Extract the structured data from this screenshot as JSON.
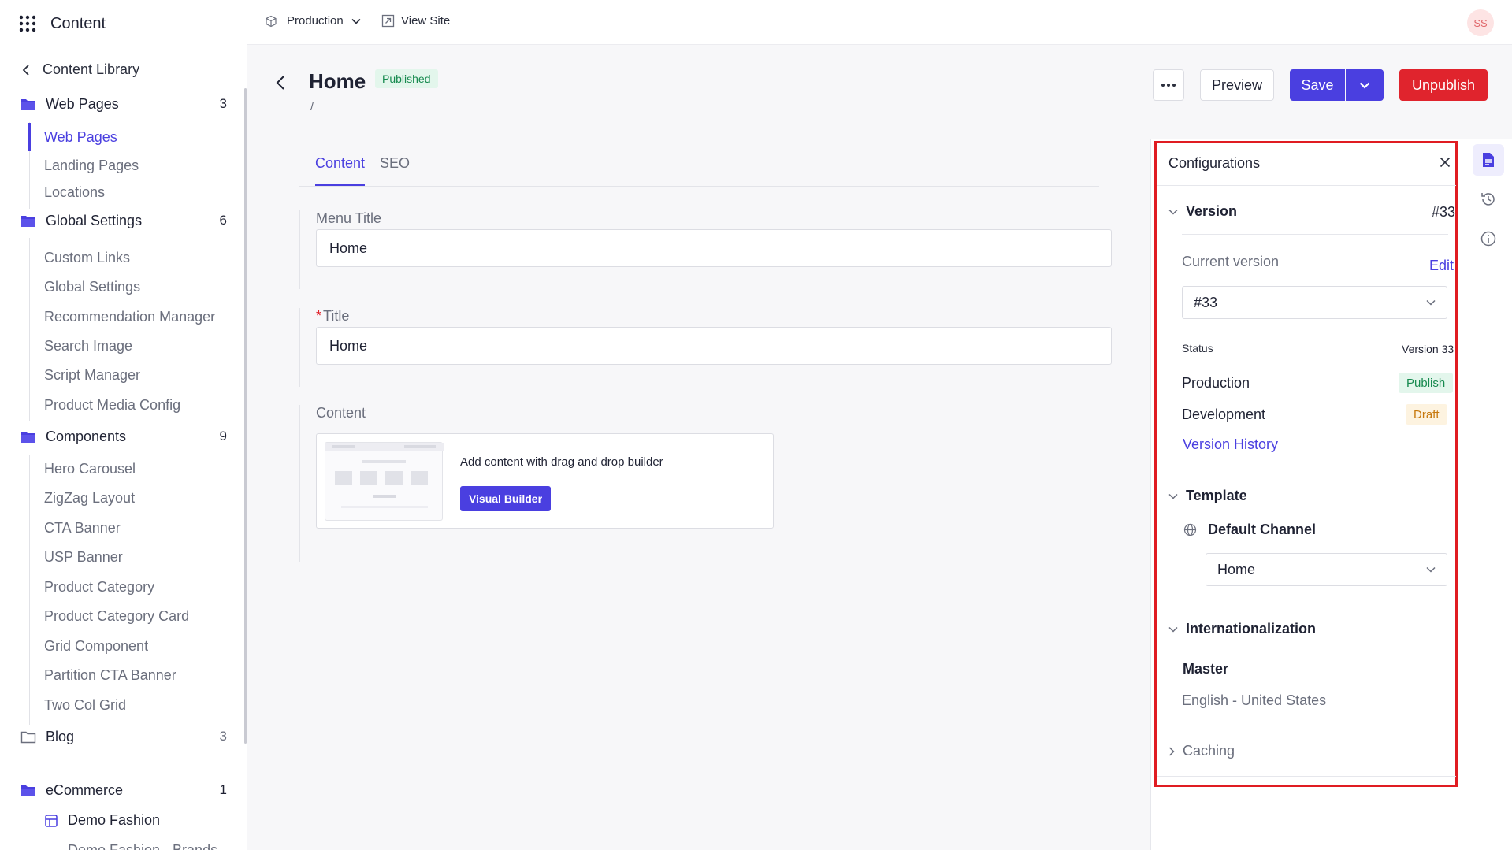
{
  "app": {
    "title": "Content"
  },
  "topbar": {
    "environment": "Production",
    "view_site": "View Site",
    "avatar_initials": "SS"
  },
  "sidebar": {
    "back_label": "Content Library",
    "folders": [
      {
        "name": "Web Pages",
        "count": "3",
        "items": [
          "Web Pages",
          "Landing Pages",
          "Locations"
        ],
        "active_item": "Web Pages"
      },
      {
        "name": "Global Settings",
        "count": "6",
        "items": [
          "Custom Links",
          "Global Settings",
          "Recommendation Manager",
          "Search Image",
          "Script Manager",
          "Product Media Config"
        ]
      },
      {
        "name": "Components",
        "count": "9",
        "items": [
          "Hero Carousel",
          "ZigZag Layout",
          "CTA Banner",
          "USP Banner",
          "Product Category",
          "Product Category Card",
          "Grid Component",
          "Partition CTA Banner",
          "Two Col Grid"
        ]
      },
      {
        "name": "Blog",
        "count": "3",
        "items": []
      },
      {
        "name": "eCommerce",
        "count": "1",
        "items": []
      }
    ],
    "store": {
      "name": "Demo Fashion",
      "child": "Demo Fashion - Brands"
    }
  },
  "header": {
    "title": "Home",
    "status": "Published",
    "slug": "/",
    "preview_label": "Preview",
    "save_label": "Save",
    "unpublish_label": "Unpublish"
  },
  "tabs": [
    {
      "label": "Content",
      "active": true
    },
    {
      "label": "SEO",
      "active": false
    }
  ],
  "form": {
    "menu_title": {
      "label": "Menu Title",
      "value": "Home"
    },
    "title": {
      "label": "Title",
      "required_mark": "*",
      "value": "Home"
    },
    "content": {
      "label": "Content",
      "hint": "Add content with drag and drop builder",
      "button": "Visual Builder"
    }
  },
  "config": {
    "title": "Configurations",
    "version": {
      "heading": "Version",
      "number": "#33",
      "current_label": "Current version",
      "edit_label": "Edit",
      "selected": "#33",
      "status_label": "Status",
      "status_value": "Version 33",
      "environments": [
        {
          "name": "Production",
          "state": "Publish"
        },
        {
          "name": "Development",
          "state": "Draft"
        }
      ],
      "history_link": "Version History"
    },
    "template": {
      "heading": "Template",
      "channel": "Default Channel",
      "selected": "Home"
    },
    "i18n": {
      "heading": "Internationalization",
      "master_label": "Master",
      "locale": "English - United States"
    },
    "caching": {
      "heading": "Caching"
    }
  },
  "colors": {
    "accent": "#4a3fe0",
    "danger": "#e0242d",
    "success_bg": "#e3f6ec",
    "success_fg": "#178a4f",
    "draft_fg": "#c7780c"
  },
  "icons": [
    "apps-grid-icon",
    "chevron-left-icon",
    "folder-icon",
    "cube-icon",
    "chevron-down-icon",
    "external-link-icon",
    "more-icon",
    "close-icon",
    "globe-icon",
    "document-icon",
    "history-icon",
    "info-icon",
    "store-icon",
    "chevron-right-icon"
  ]
}
